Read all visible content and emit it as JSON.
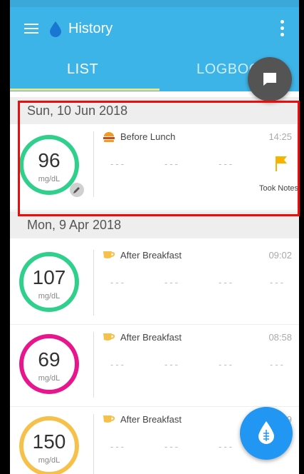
{
  "app": {
    "title": "History"
  },
  "tabs": {
    "list_label": "LIST",
    "logbook_label": "LOGBOOK"
  },
  "colors": {
    "appbar": "#3DB4E8",
    "ring_green": "#2FCF8C",
    "ring_pink": "#E8168D",
    "ring_orange": "#F6C14A",
    "highlight": "#F00A0A",
    "fab": "#2196F3"
  },
  "sections": [
    {
      "date": "Sun, 10 Jun 2018",
      "entries": [
        {
          "value": "96",
          "unit": "mg/dL",
          "meal": "Before Lunch",
          "time": "14:25",
          "meal_icon": "burger-icon",
          "dashes": [
            "---",
            "---",
            "---"
          ],
          "note_label": "Took Notes"
        }
      ]
    },
    {
      "date": "Mon, 9 Apr 2018",
      "entries": [
        {
          "value": "107",
          "unit": "mg/dL",
          "meal": "After Breakfast",
          "time": "09:02",
          "meal_icon": "cup-icon",
          "dashes": [
            "---",
            "---",
            "---",
            "---"
          ]
        },
        {
          "value": "69",
          "unit": "mg/dL",
          "meal": "After Breakfast",
          "time": "08:58",
          "meal_icon": "cup-icon",
          "dashes": [
            "---",
            "---",
            "---",
            "---"
          ]
        },
        {
          "value": "150",
          "unit": "mg/dL",
          "meal": "After Breakfast",
          "time": "49",
          "meal_icon": "cup-icon",
          "dashes": [
            "---",
            "---",
            "---"
          ]
        }
      ]
    }
  ],
  "icons": {
    "menu": "hamburger-menu-icon",
    "logo": "blood-drop-icon",
    "more": "more-vert-icon",
    "chat": "chat-bubble-icon",
    "edit": "pencil-icon",
    "flag": "flag-icon",
    "fab": "add-reading-icon"
  }
}
